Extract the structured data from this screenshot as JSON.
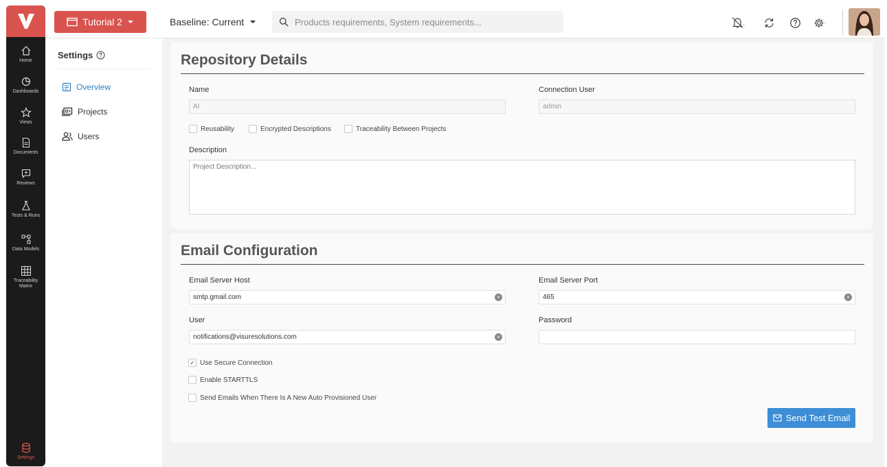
{
  "topbar": {
    "project_name": "Tutorial 2",
    "baseline": "Baseline: Current",
    "search_placeholder": "Products requirements, System requirements..."
  },
  "rail": {
    "items": [
      {
        "label": "Home",
        "icon": "home-icon"
      },
      {
        "label": "Dashboards",
        "icon": "dashboard-icon"
      },
      {
        "label": "Views",
        "icon": "star-icon"
      },
      {
        "label": "Documents",
        "icon": "document-icon"
      },
      {
        "label": "Reviews",
        "icon": "review-icon"
      },
      {
        "label": "Tests & Runs",
        "icon": "flask-icon"
      },
      {
        "label": "Data Models",
        "icon": "data-model-icon"
      },
      {
        "label": "Traceability Matrix",
        "icon": "matrix-icon"
      }
    ],
    "settings_label": "Settings"
  },
  "settings_nav": {
    "title": "Settings",
    "items": [
      {
        "label": "Overview",
        "active": true
      },
      {
        "label": "Projects",
        "active": false
      },
      {
        "label": "Users",
        "active": false
      }
    ]
  },
  "repository": {
    "heading": "Repository Details",
    "name_label": "Name",
    "name_value": "AI",
    "connection_user_label": "Connection User",
    "connection_user_value": "admin",
    "checkboxes": [
      {
        "label": "Reusability",
        "checked": false
      },
      {
        "label": "Encrypted Descriptions",
        "checked": false
      },
      {
        "label": "Traceability Between Projects",
        "checked": false
      }
    ],
    "description_label": "Description",
    "description_placeholder": "Project Description..."
  },
  "email": {
    "heading": "Email Configuration",
    "host_label": "Email Server Host",
    "host_value": "smtp.gmail.com",
    "port_label": "Email Server Port",
    "port_value": "465",
    "user_label": "User",
    "user_value": "notifications@visuresolutions.com",
    "password_label": "Password",
    "password_value": "",
    "checkboxes": [
      {
        "label": "Use Secure Connection",
        "checked": true
      },
      {
        "label": "Enable STARTTLS",
        "checked": false
      },
      {
        "label": "Send Emails When There Is A New Auto Provisioned User",
        "checked": false
      }
    ],
    "send_button": "Send Test Email"
  },
  "colors": {
    "brand_red": "#d9534f",
    "rail_bg": "#1b1b1b",
    "accent_blue": "#3d8ed6"
  }
}
